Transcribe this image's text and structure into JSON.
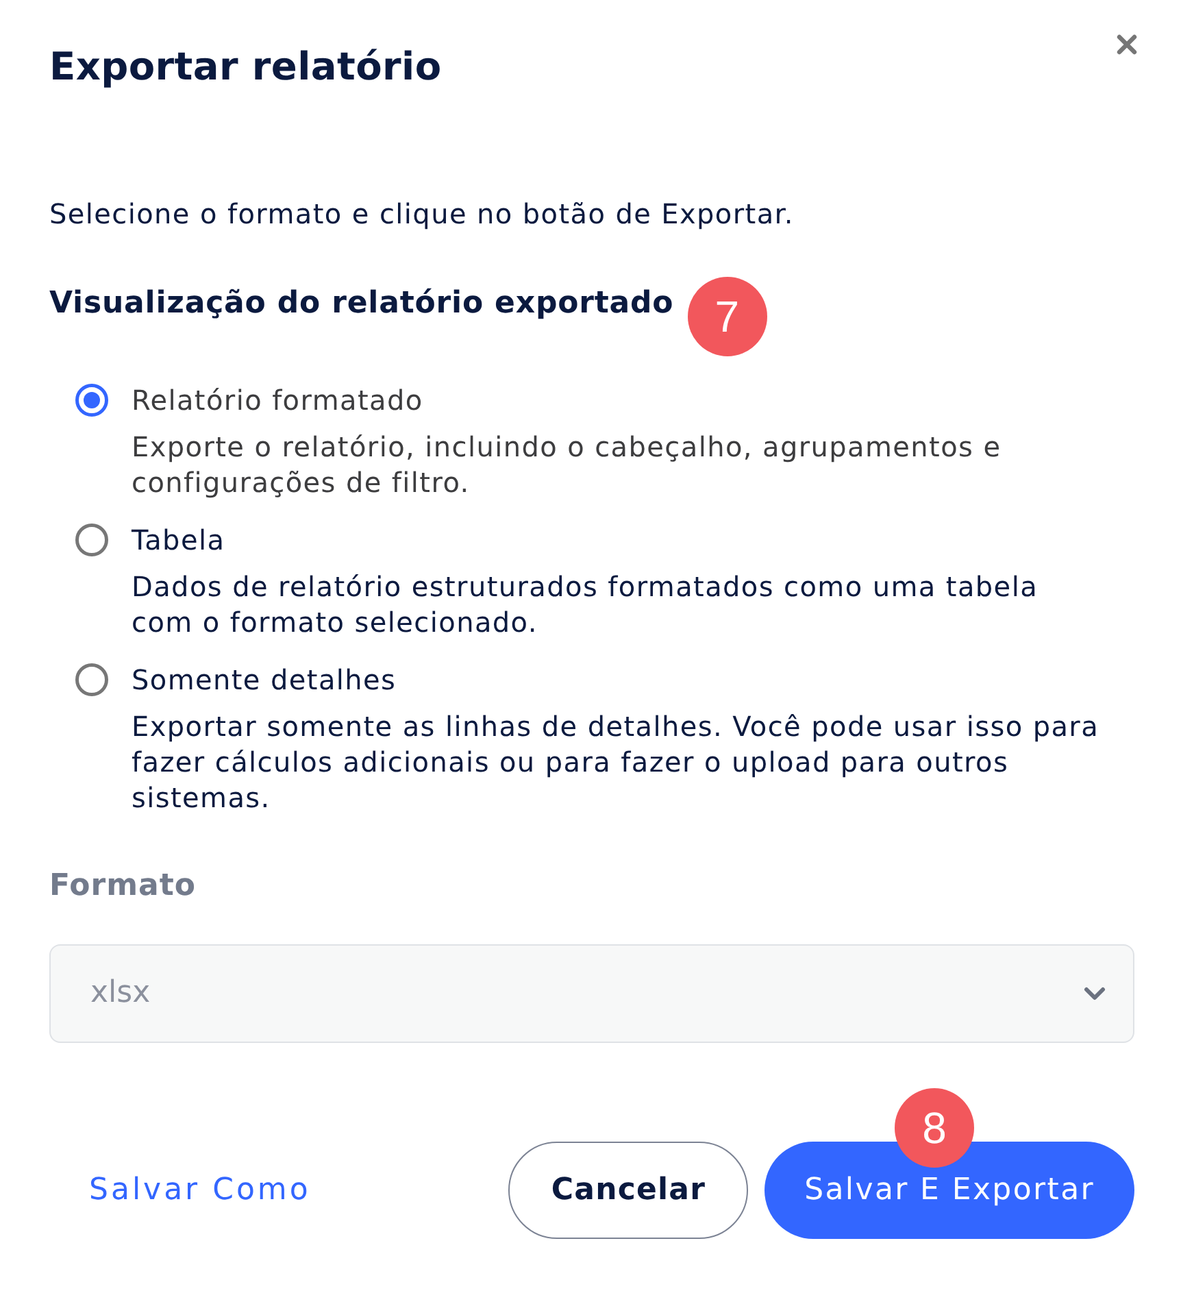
{
  "dialog": {
    "title": "Exportar relatório",
    "instruction": "Selecione o formato e clique no botão de Exportar."
  },
  "section": {
    "heading": "Visualização do relatório exportado",
    "step_badge": "7"
  },
  "options": [
    {
      "label": "Relatório formatado",
      "description": "Exporte o relatório, incluindo o cabeçalho, agrupamentos e configurações de filtro.",
      "selected": true
    },
    {
      "label": "Tabela",
      "description": "Dados de relatório estruturados formatados como uma tabela com o formato selecionado.",
      "selected": false
    },
    {
      "label": "Somente detalhes",
      "description": "Exportar somente as linhas de detalhes. Você pode usar isso para fazer cálculos adicionais ou para fazer o upload para outros sistemas.",
      "selected": false
    }
  ],
  "format": {
    "label": "Formato",
    "value": "xlsx",
    "disabled": true
  },
  "footer": {
    "link": "Salvar Como",
    "buttons": [
      {
        "label": "Cancelar",
        "kind": "secondary"
      },
      {
        "label": "Salvar E Exportar",
        "kind": "primary",
        "step_badge": "8"
      }
    ]
  }
}
